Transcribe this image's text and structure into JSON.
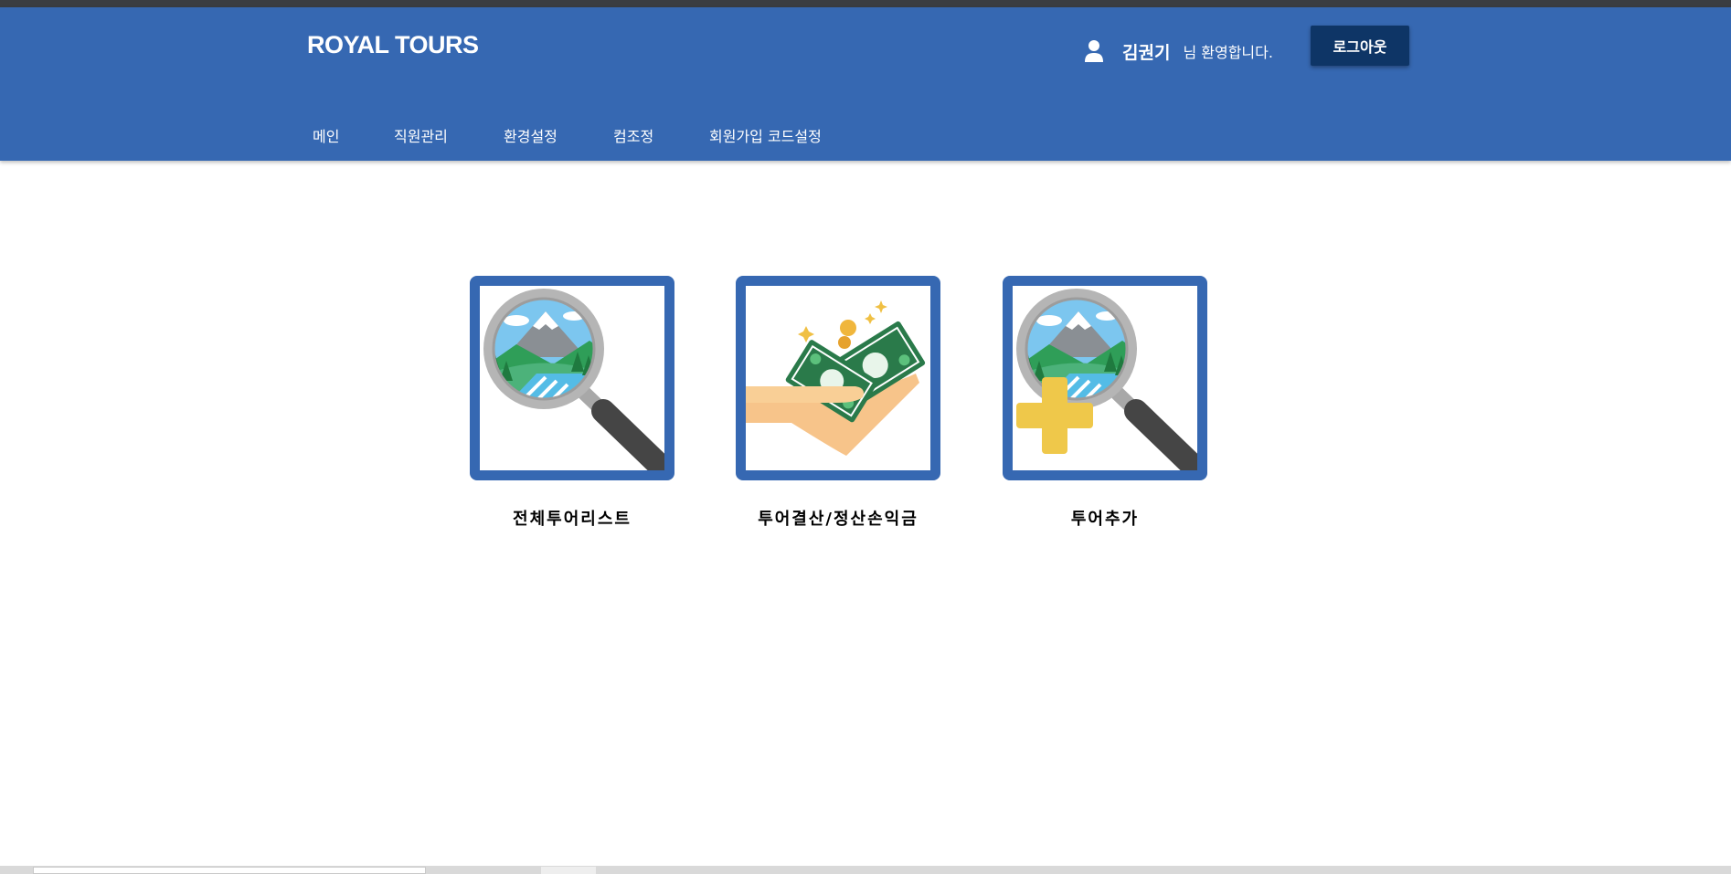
{
  "header": {
    "brand": "ROYAL TOURS",
    "user_name": "김권기",
    "welcome_text": "님 환영합니다.",
    "logout_label": "로그아웃",
    "user_icon": "user-icon"
  },
  "nav": {
    "items": [
      {
        "label": "메인"
      },
      {
        "label": "직원관리"
      },
      {
        "label": "환경설정"
      },
      {
        "label": "컴조정"
      },
      {
        "label": "회원가입 코드설정"
      }
    ]
  },
  "tiles": [
    {
      "label": "전체투어리스트",
      "icon": "magnifier-landscape-icon"
    },
    {
      "label": "투어결산/정산손익금",
      "icon": "hand-money-icon"
    },
    {
      "label": "투어추가",
      "icon": "magnifier-add-icon"
    }
  ],
  "colors": {
    "header_bg": "#3668b2",
    "logout_bg": "#0e3566",
    "tile_border": "#3668b2"
  }
}
